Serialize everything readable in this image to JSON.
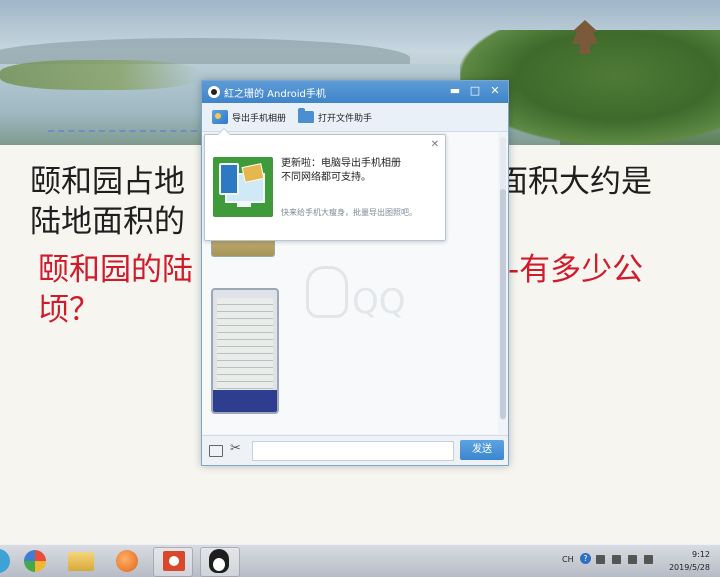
{
  "slide": {
    "line1_left": "颐和园占地",
    "line1_right": "面积大约是",
    "line2": "陆地面积的",
    "line3_left": "颐和园的陆",
    "line3_right": "-有多少公",
    "line4": "顷？"
  },
  "qq_window": {
    "title": "紅之珊的 Android手机",
    "minimize": "▬",
    "maximize": "□",
    "close": "✕",
    "toolbar": {
      "export_album": "导出手机相册",
      "open_file_helper": "打开文件助手"
    },
    "watermark": "QQ",
    "send_label": "发送",
    "input_value": ""
  },
  "popup": {
    "close": "✕",
    "message_line1": "更新啦：电脑导出手机相册",
    "message_line2": "不同网络都可支持。",
    "hint": "快来给手机大瘦身，批量导出图照吧。"
  },
  "taskbar": {
    "tray_lang": "CH",
    "tray_help": "?",
    "time": "9:12",
    "date": "2019/5/28"
  },
  "colors": {
    "title_blue": "#3f84c9",
    "send_blue": "#3a86cf",
    "red_text": "#d11a2a"
  }
}
